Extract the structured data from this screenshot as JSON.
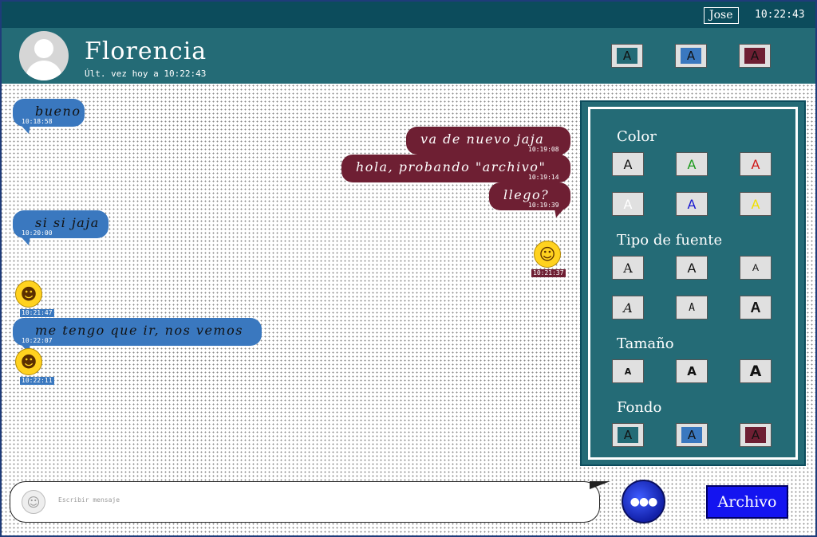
{
  "topbar": {
    "user": "Jose",
    "time": "10:22:43"
  },
  "header": {
    "contact_name": "Florencia",
    "last_seen": "Últ. vez hoy a 10:22:43",
    "bg_swatches": [
      {
        "label": "A",
        "color": "#246b76"
      },
      {
        "label": "A",
        "color": "#3a78bf"
      },
      {
        "label": "A",
        "color": "#6e1f33"
      }
    ]
  },
  "messages": [
    {
      "text": "bueno",
      "time": "10:18:58",
      "side": "in"
    },
    {
      "text": "va de nuevo jaja",
      "time": "10:19:08",
      "side": "out"
    },
    {
      "text": "hola, probando \"archivo\"",
      "time": "10:19:14",
      "side": "out"
    },
    {
      "text": "llego?",
      "time": "10:19:39",
      "side": "out"
    },
    {
      "text": "si si jaja",
      "time": "10:20:00",
      "side": "in"
    },
    {
      "emoji": "grinning-face",
      "glyph": "☺",
      "time": "10:21:37",
      "side": "out"
    },
    {
      "emoji": "squinting-tongue-face",
      "glyph": "☻",
      "time": "10:21:47",
      "side": "in"
    },
    {
      "text": "me tengo que ir, nos vemos",
      "time": "10:22:07",
      "side": "in"
    },
    {
      "emoji": "kissing-winking-face",
      "glyph": "☻",
      "time": "10:22:11",
      "side": "in"
    }
  ],
  "panel": {
    "color_title": "Color",
    "colors": [
      {
        "label": "A",
        "text_color": "#111111"
      },
      {
        "label": "A",
        "text_color": "#1a9a1a"
      },
      {
        "label": "A",
        "text_color": "#d01818"
      },
      {
        "label": "A",
        "text_color": "#ffffff"
      },
      {
        "label": "A",
        "text_color": "#1818d0"
      },
      {
        "label": "A",
        "text_color": "#f0e000"
      }
    ],
    "font_title": "Tipo de fuente",
    "fonts": [
      "A",
      "A",
      "A",
      "A",
      "A",
      "A"
    ],
    "size_title": "Tamaño",
    "sizes": [
      "A",
      "A",
      "A"
    ],
    "background_title": "Fondo",
    "backgrounds": [
      {
        "label": "A",
        "color": "#246b76"
      },
      {
        "label": "A",
        "color": "#3a78bf"
      },
      {
        "label": "A",
        "color": "#6e1f33"
      }
    ]
  },
  "composer": {
    "placeholder": "Escribir mensaje",
    "emoji_icon": "smiley-icon",
    "send_icon": "animated-emoji-orb",
    "file_button": "Archivo"
  }
}
